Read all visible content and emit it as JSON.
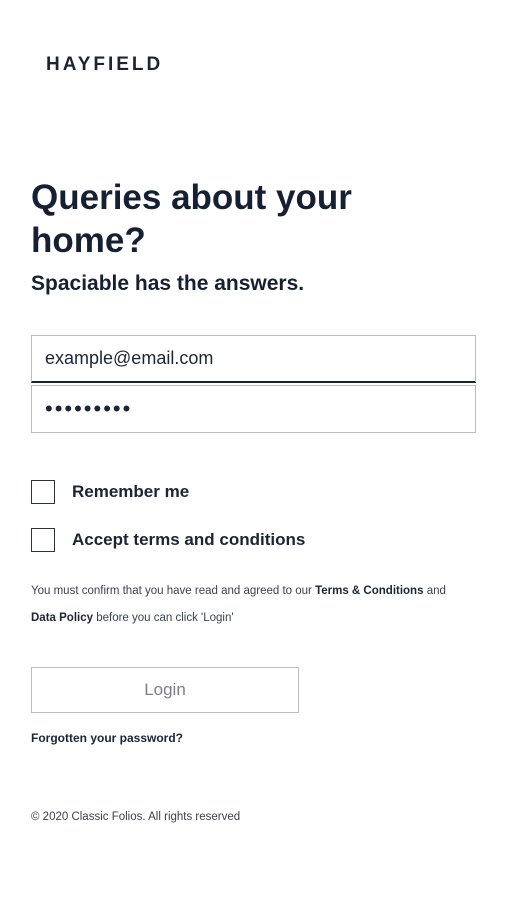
{
  "brand": {
    "logo_text": "HAYFIELD"
  },
  "hero": {
    "title": "Queries about your home?",
    "subtitle": "Spaciable has the answers."
  },
  "form": {
    "email_value": "example@email.com",
    "password_value": "password1",
    "remember_label": "Remember me",
    "remember_checked": false,
    "terms_label": "Accept terms and conditions",
    "terms_checked": false,
    "notice_prefix": "You must confirm that you have read and agreed to our",
    "notice_terms_link": "Terms & Conditions",
    "notice_and": "and",
    "notice_policy_link": "Data Policy",
    "notice_suffix": "before you can click 'Login'",
    "login_label": "Login",
    "forgot_label": "Forgotten your password?"
  },
  "footer": {
    "copyright": "© 2020 Classic Folios. All rights reserved"
  },
  "colors": {
    "text": "#1c2535",
    "border": "#b9bcc2",
    "muted_button_text": "#7d8088"
  }
}
